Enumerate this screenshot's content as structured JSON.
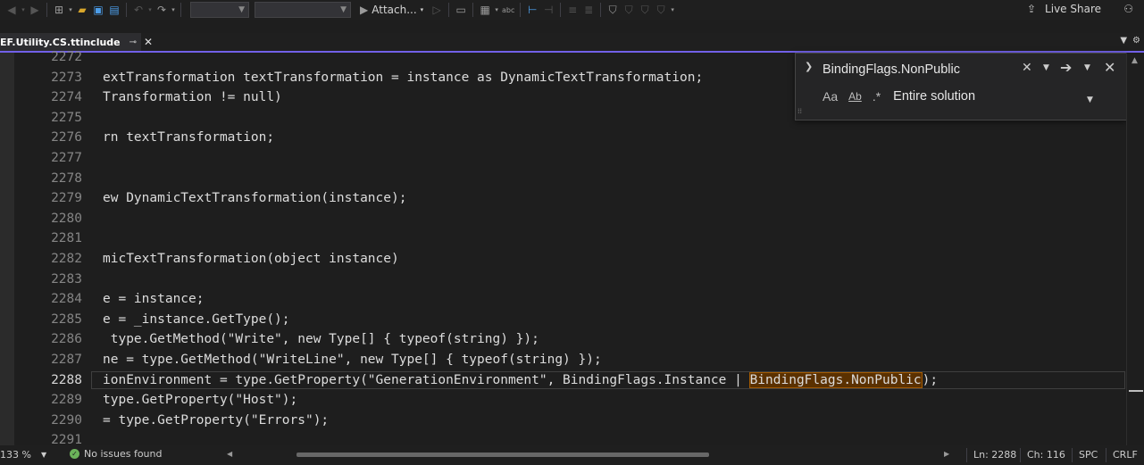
{
  "toolbar": {
    "attach_label": "Attach...",
    "live_share_label": "Live Share"
  },
  "tab": {
    "filename": "EF.Utility.CS.ttinclude"
  },
  "editor": {
    "lines": [
      {
        "n": "2272",
        "code": ""
      },
      {
        "n": "2273",
        "code": "extTransformation textTransformation = instance as DynamicTextTransformation;"
      },
      {
        "n": "2274",
        "code": "Transformation != null)"
      },
      {
        "n": "2275",
        "code": ""
      },
      {
        "n": "2276",
        "code": "rn textTransformation;"
      },
      {
        "n": "2277",
        "code": ""
      },
      {
        "n": "2278",
        "code": ""
      },
      {
        "n": "2279",
        "code": "ew DynamicTextTransformation(instance);"
      },
      {
        "n": "2280",
        "code": ""
      },
      {
        "n": "2281",
        "code": ""
      },
      {
        "n": "2282",
        "code": "micTextTransformation(object instance)"
      },
      {
        "n": "2283",
        "code": ""
      },
      {
        "n": "2284",
        "code": "e = instance;"
      },
      {
        "n": "2285",
        "code": "e = _instance.GetType();"
      },
      {
        "n": "2286",
        "code": " type.GetMethod(\"Write\", new Type[] { typeof(string) });"
      },
      {
        "n": "2287",
        "code": "ne = type.GetMethod(\"WriteLine\", new Type[] { typeof(string) });"
      },
      {
        "n": "2288",
        "code": "ionEnvironment = type.GetProperty(\"GenerationEnvironment\", BindingFlags.Instance | ",
        "match": "BindingFlags.NonPublic",
        "after": ");",
        "current": true
      },
      {
        "n": "2289",
        "code": "type.GetProperty(\"Host\");"
      },
      {
        "n": "2290",
        "code": "= type.GetProperty(\"Errors\");"
      },
      {
        "n": "2291",
        "code": ""
      }
    ]
  },
  "find": {
    "query": "BindingFlags.NonPublic",
    "match_case_label": "Aa",
    "whole_word_label": "Ab",
    "regex_label": ".*",
    "scope": "Entire solution"
  },
  "status": {
    "zoom": "133 %",
    "issues": "No issues found",
    "line": "Ln: 2288",
    "col": "Ch: 116",
    "indent": "SPC",
    "eol": "CRLF"
  }
}
